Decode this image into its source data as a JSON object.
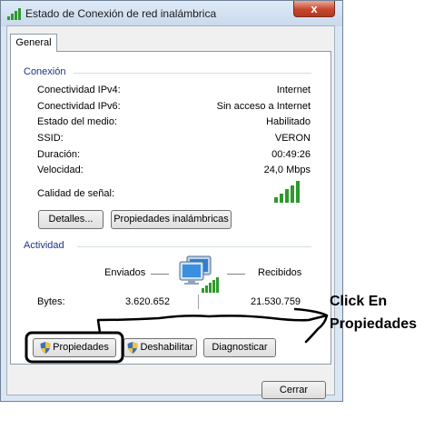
{
  "window": {
    "title": "Estado de Conexión de red inalámbrica",
    "close_label": "x"
  },
  "tabs": {
    "general": "General"
  },
  "connection": {
    "heading": "Conexión",
    "rows": [
      {
        "label": "Conectividad IPv4:",
        "value": "Internet"
      },
      {
        "label": "Conectividad IPv6:",
        "value": "Sin acceso a Internet"
      },
      {
        "label": "Estado del medio:",
        "value": "Habilitado"
      },
      {
        "label": "SSID:",
        "value": "VERON"
      },
      {
        "label": "Duración:",
        "value": "00:49:26"
      },
      {
        "label": "Velocidad:",
        "value": "24,0 Mbps"
      }
    ],
    "signal_label": "Calidad de señal:",
    "details_button": "Detalles...",
    "wireless_props_button": "Propiedades inalámbricas"
  },
  "activity": {
    "heading": "Actividad",
    "sent_label": "Enviados",
    "received_label": "Recibidos",
    "bytes_label": "Bytes:",
    "bytes_sent": "3.620.652",
    "bytes_received": "21.530.759",
    "properties_button": "Propiedades",
    "disable_button": "Deshabilitar",
    "diagnose_button": "Diagnosticar"
  },
  "footer": {
    "close_button": "Cerrar"
  },
  "annotation": {
    "line1": "Click En",
    "line2": "Propiedades"
  },
  "colors": {
    "signal_green": "#2e9a2e",
    "group_heading": "#1e3287",
    "titlebar": "#d3e1f1"
  }
}
